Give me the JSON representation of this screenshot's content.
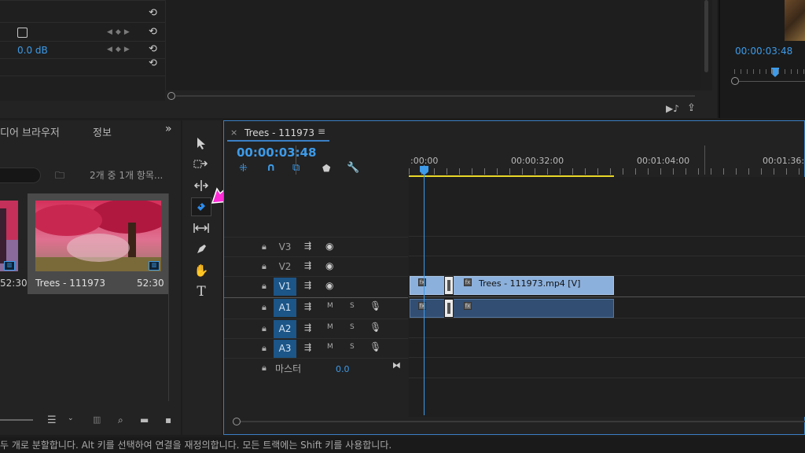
{
  "effect_controls": {
    "volume_value": "0.0 dB"
  },
  "program_monitor": {
    "timecode": "00:00:03:48"
  },
  "project": {
    "tab_media_browser": "디어 브라우저",
    "tab_info": "정보",
    "item_count": "2개 중 1개 항목...",
    "left_clip_duration": "52:30",
    "clip_name": "Trees - 111973",
    "clip_duration": "52:30"
  },
  "timeline": {
    "sequence_name": "Trees - 111973",
    "timecode": "00:00:03:48",
    "ruler_labels": [
      ":00:00",
      "00:00:32:00",
      "00:01:04:00",
      "00:01:36:"
    ],
    "tracks": {
      "v3": "V3",
      "v2": "V2",
      "v1": "V1",
      "a1": "A1",
      "a2": "A2",
      "a3": "A3",
      "master": "마스터",
      "master_value": "0.0",
      "mute": "M",
      "solo": "S"
    },
    "video_clip_label": "Trees - 111973.mp4 [V]"
  },
  "status_bar": {
    "text": "두 개로 분할합니다. Alt 키를 선택하여 연결을 재정의합니다. 모든 트랙에는 Shift 키를 사용합니다."
  },
  "colors": {
    "accent": "#3d9be9",
    "annotation": "#ff2bd6",
    "video_clip": "#8cb0dc",
    "audio_clip": "#324e72",
    "work_area": "#e8d828"
  }
}
